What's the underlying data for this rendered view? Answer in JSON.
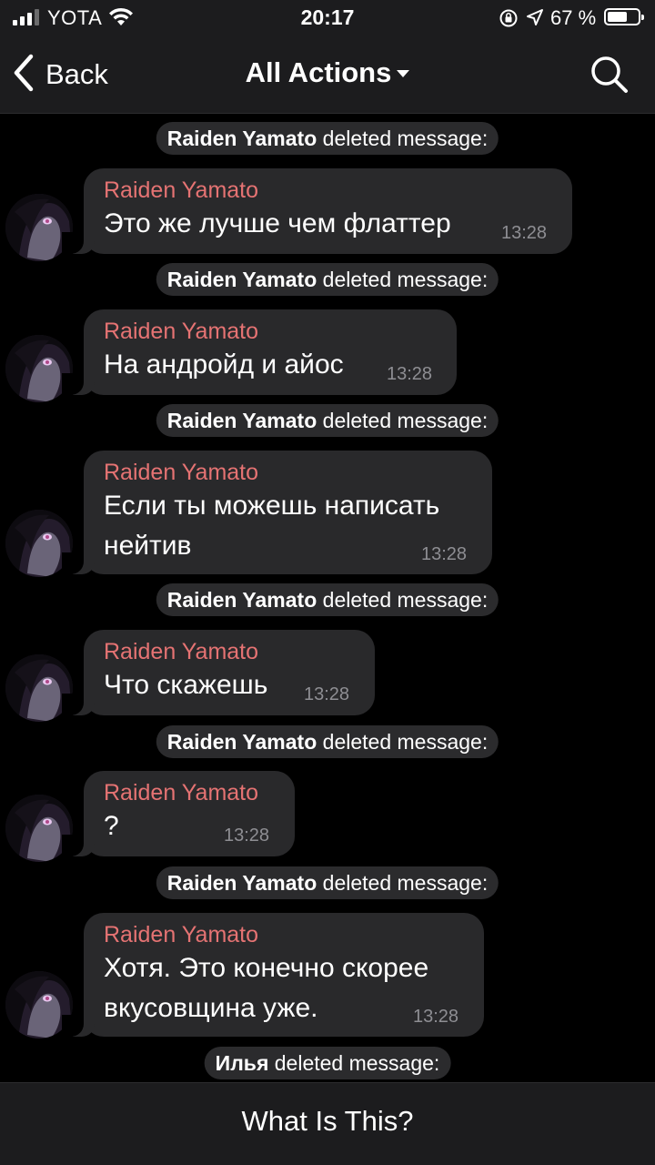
{
  "status_bar": {
    "carrier": "YOTA",
    "time": "20:17",
    "battery_percent": "67 %",
    "battery_level": 0.67,
    "icons": [
      "signal-icon",
      "wifi-icon",
      "orientation-lock-icon",
      "location-icon",
      "battery-icon"
    ]
  },
  "nav": {
    "back_label": "Back",
    "title": "All Actions",
    "icons": [
      "chevron-left-icon",
      "caret-down-icon",
      "search-icon"
    ]
  },
  "colors": {
    "background": "#000000",
    "bar": "#1c1c1e",
    "bubble": "#29292b",
    "service_pill": "#2b2b2d",
    "sender_name": "#e57373",
    "timestamp": "#8e8e93"
  },
  "log": [
    {
      "service": {
        "user": "Raiden Yamato",
        "action": "deleted message:"
      },
      "message": {
        "sender": "Raiden Yamato",
        "lines": [
          "Это же лучше чем флаттер"
        ],
        "time": "13:28"
      }
    },
    {
      "service": {
        "user": "Raiden Yamato",
        "action": "deleted message:"
      },
      "message": {
        "sender": "Raiden Yamato",
        "lines": [
          "На андройд и айос"
        ],
        "time": "13:28"
      }
    },
    {
      "service": {
        "user": "Raiden Yamato",
        "action": "deleted message:"
      },
      "message": {
        "sender": "Raiden Yamato",
        "lines": [
          "Если ты можешь написать",
          "нейтив"
        ],
        "time": "13:28"
      }
    },
    {
      "service": {
        "user": "Raiden Yamato",
        "action": "deleted message:"
      },
      "message": {
        "sender": "Raiden Yamato",
        "lines": [
          "Что скажешь"
        ],
        "time": "13:28"
      }
    },
    {
      "service": {
        "user": "Raiden Yamato",
        "action": "deleted message:"
      },
      "message": {
        "sender": "Raiden Yamato",
        "lines": [
          "?"
        ],
        "time": "13:28"
      }
    },
    {
      "service": {
        "user": "Raiden Yamato",
        "action": "deleted message:"
      },
      "message": {
        "sender": "Raiden Yamato",
        "lines": [
          "Хотя. Это конечно скорее",
          "вкусовщина уже."
        ],
        "time": "13:28"
      }
    },
    {
      "service": {
        "user": "Илья",
        "action": "deleted message:"
      }
    }
  ],
  "bottom_bar": {
    "button_label": "What Is This?"
  }
}
